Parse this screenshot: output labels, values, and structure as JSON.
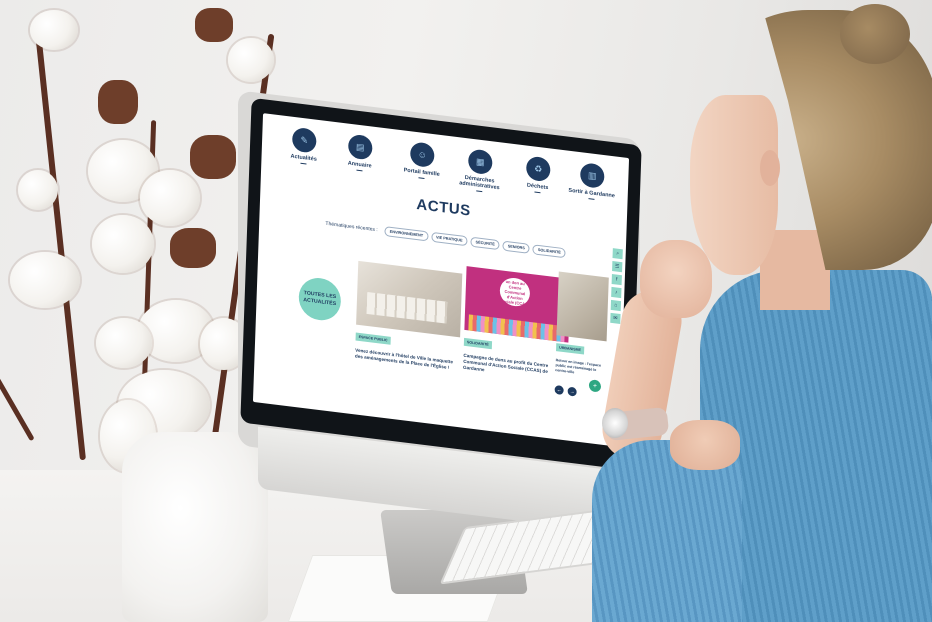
{
  "scene": {
    "description_free": true
  },
  "website": {
    "nav": [
      {
        "label": "Actualités",
        "icon": "megaphone-icon"
      },
      {
        "label": "Annuaire",
        "icon": "book-icon"
      },
      {
        "label": "Portail famille",
        "icon": "family-icon"
      },
      {
        "label": "Démarches administratives",
        "icon": "document-icon"
      },
      {
        "label": "Déchets",
        "icon": "trash-icon"
      },
      {
        "label": "Sortir à Gardanne",
        "icon": "calendar-icon"
      }
    ],
    "page_title": "ACTUS",
    "themes_label": "Thématiques récentes :",
    "themes": [
      "ENVIRONNEMENT",
      "VIE PRATIQUE",
      "SÉCURITÉ",
      "SENIORS",
      "SOLIDARITÉ"
    ],
    "all_news_label": "TOUTES LES ACTUALITÉS",
    "cards": [
      {
        "tag": "ESPACE PUBLIC",
        "text": "Venez découvrir à l'hôtel de Ville la maquette des aménagements de la Place de l'Église !"
      },
      {
        "tag": "SOLIDARITÉ",
        "text": "Campagne de dons au profit du Centre Communal d'Action Sociale (CCAS) de Gardanne",
        "bubble": "un don au Centre Communal d'Action Sociale (CCAS)"
      },
      {
        "tag": "URBANISME",
        "text": "Retour en image : l'espace public est réaménagé le centre-ville"
      }
    ],
    "pager": {
      "prev": "←",
      "next": "→"
    },
    "fab": "+",
    "side_tools": [
      "⌕",
      "☰",
      "f",
      "♪",
      "⌂",
      "✉"
    ]
  },
  "colors": {
    "brand_navy": "#1e3a5f",
    "accent_mint": "#7fd3c2",
    "accent_pink": "#c1307f",
    "accent_green": "#2ea782"
  }
}
